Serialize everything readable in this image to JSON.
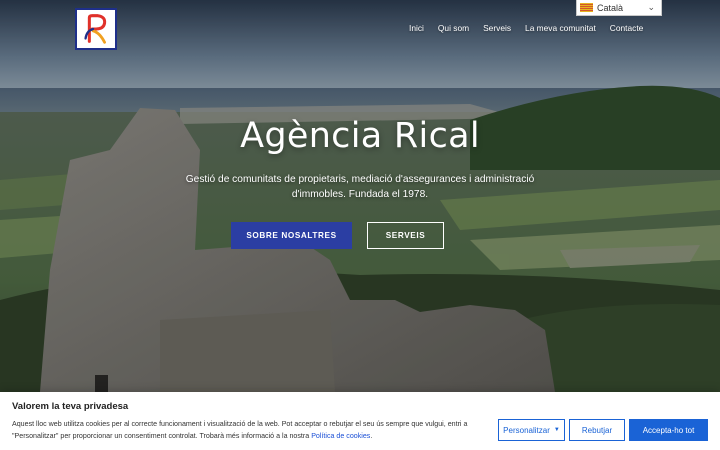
{
  "nav": {
    "items": [
      {
        "label": "Inici"
      },
      {
        "label": "Qui som"
      },
      {
        "label": "Serveis"
      },
      {
        "label": "La meva comunitat"
      },
      {
        "label": "Contacte"
      }
    ]
  },
  "language": {
    "selected": "Català",
    "icon": "chevron-down-icon"
  },
  "hero": {
    "title": "Agència Rical",
    "subtitle": "Gestió de comunitats de propietaris, mediació d'assegurances i administració d'immobles. Fundada el 1978.",
    "primary_button": "SOBRE NOSALTRES",
    "secondary_button": "SERVEIS"
  },
  "cookie": {
    "heading": "Valorem la teva privadesa",
    "text": "Aquest lloc web utilitza cookies per al correcte funcionament i visualització de la web. Pot acceptar o rebutjar el seu ús sempre que vulgui, entri a \"Personalitzar\" per proporcionar un consentiment controlat. Trobarà més informació a la nostra ",
    "link": "Política de cookies",
    "link_suffix": ".",
    "customize": "Personalitzar",
    "reject": "Rebutjar",
    "accept": "Accepta-ho tot"
  },
  "colors": {
    "primary": "#2b3ea3",
    "cookie_accent": "#1a63d6",
    "logo_red": "#e0312a",
    "logo_blue": "#1e2f8a",
    "logo_orange": "#f0a020"
  }
}
